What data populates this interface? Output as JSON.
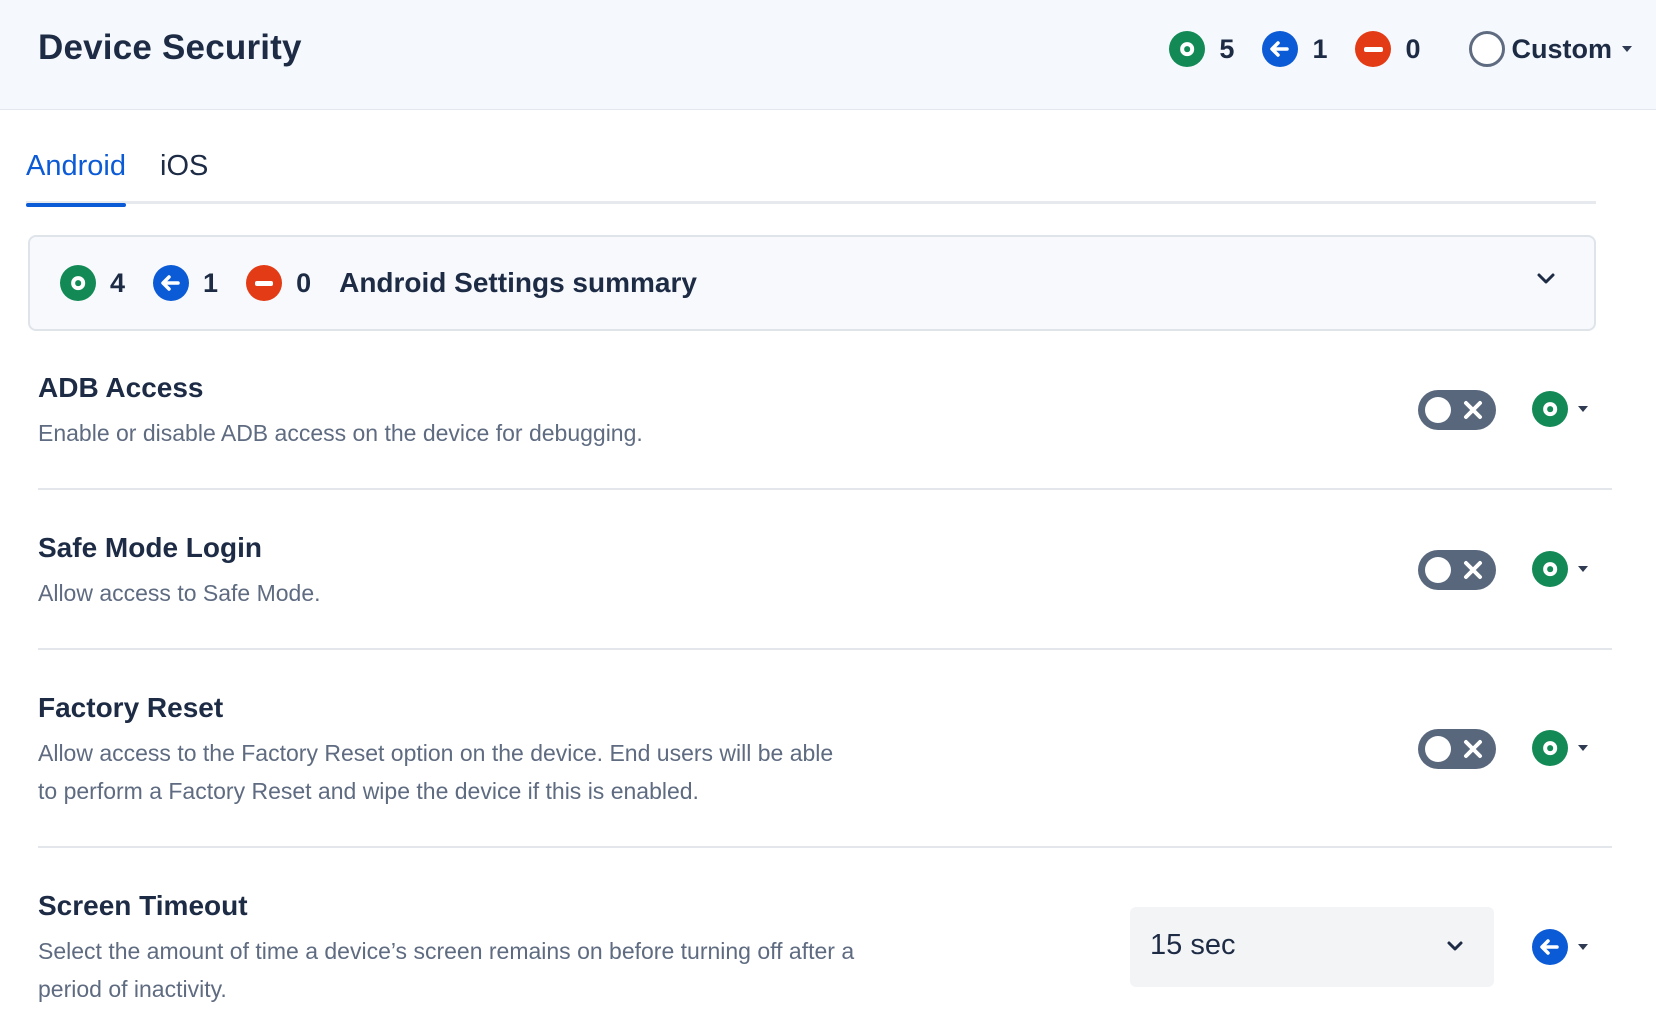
{
  "header": {
    "title": "Device Security",
    "stats": {
      "enforced": "5",
      "inherited": "1",
      "disabled": "0"
    },
    "profile_label": "Custom"
  },
  "tabs": [
    {
      "label": "Android",
      "active": true
    },
    {
      "label": "iOS",
      "active": false
    }
  ],
  "summary": {
    "enforced": "4",
    "inherited": "1",
    "disabled": "0",
    "title": "Android Settings summary"
  },
  "settings": [
    {
      "title": "ADB Access",
      "description": "Enable or disable ADB access on the device for debugging.",
      "control": "toggle",
      "enabled": false,
      "status_icon": "enforced-icon"
    },
    {
      "title": "Safe Mode Login",
      "description": "Allow access to Safe Mode.",
      "control": "toggle",
      "enabled": false,
      "status_icon": "enforced-icon"
    },
    {
      "title": "Factory Reset",
      "description": "Allow access to the Factory Reset option on the device. End users will be able to perform a Factory Reset and wipe the device if this is enabled.",
      "control": "toggle",
      "enabled": false,
      "status_icon": "enforced-icon"
    },
    {
      "title": "Screen Timeout",
      "description": "Select the amount of time a device’s screen remains on before turning off after a period of inactivity.",
      "control": "select",
      "value": "15 sec",
      "status_icon": "inherited-icon"
    }
  ],
  "colors": {
    "enforced": "#138a55",
    "inherited": "#0c5bd6",
    "disabled": "#e33b15",
    "toggle_off": "#59677d",
    "accent": "#0c5bd6"
  }
}
